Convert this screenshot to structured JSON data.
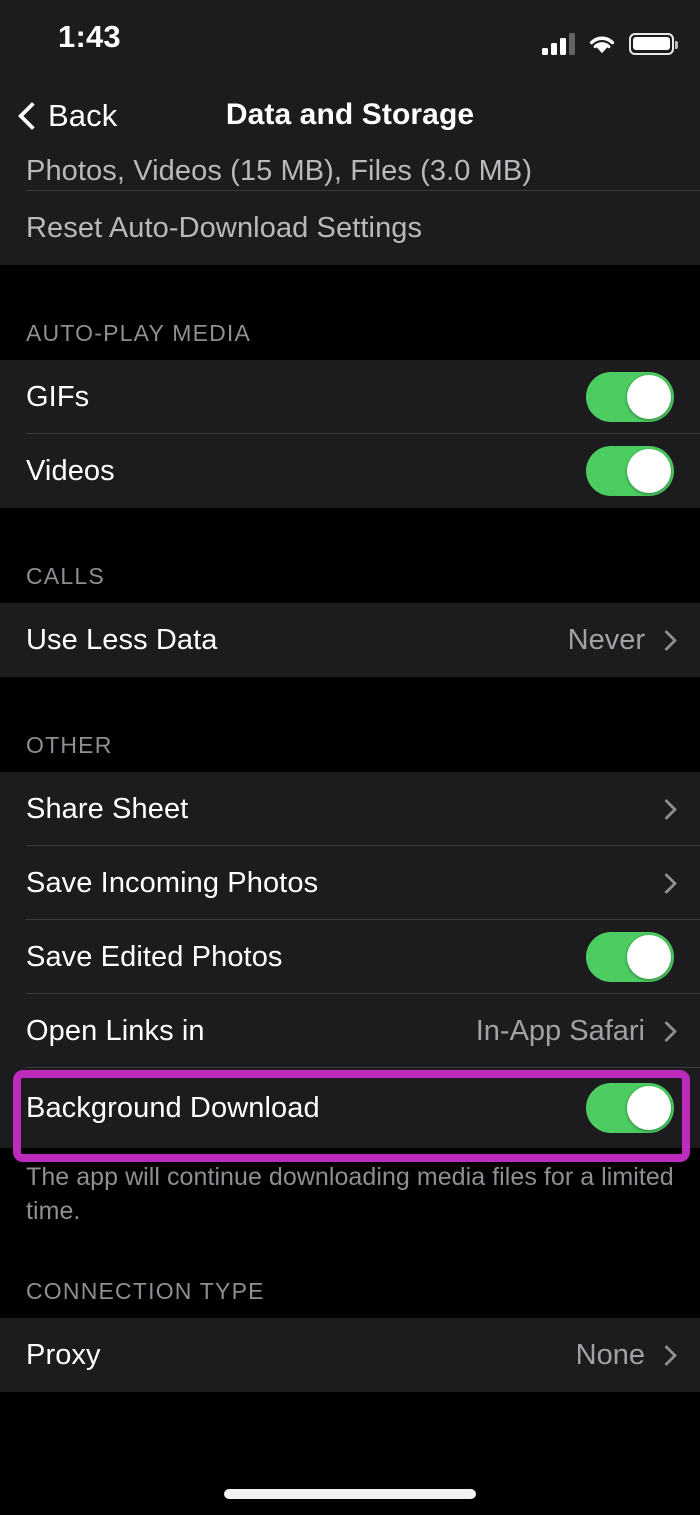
{
  "status_bar": {
    "time": "1:43",
    "signal_icon": "cellular-signal-icon",
    "signal_bars_filled": 3,
    "signal_bars_total": 4,
    "wifi_icon": "wifi-icon",
    "battery_icon": "battery-full-icon"
  },
  "nav": {
    "back_label": "Back",
    "back_icon": "chevron-left-icon",
    "title": "Data and Storage"
  },
  "colors": {
    "group_background": "#1c1c1e",
    "page_background": "#000000",
    "toggle_on": "#4ccc61",
    "highlight": "#bc2bbc",
    "secondary_text": "#8e8e93",
    "divider": "#3a3a3c"
  },
  "sections": [
    {
      "header": "",
      "partial_top_text": "Photos, Videos (15 MB), Files (3.0 MB)",
      "rows": [
        {
          "title": "Reset Auto-Download Settings",
          "type": "action"
        }
      ]
    },
    {
      "header": "AUTO-PLAY MEDIA",
      "rows": [
        {
          "title": "GIFs",
          "type": "toggle",
          "value": "on"
        },
        {
          "title": "Videos",
          "type": "toggle",
          "value": "on"
        }
      ]
    },
    {
      "header": "CALLS",
      "rows": [
        {
          "title": "Use Less Data",
          "type": "disclosure",
          "value": "Never"
        }
      ]
    },
    {
      "header": "OTHER",
      "rows": [
        {
          "title": "Share Sheet",
          "type": "disclosure",
          "value": ""
        },
        {
          "title": "Save Incoming Photos",
          "type": "disclosure",
          "value": ""
        },
        {
          "title": "Save Edited Photos",
          "type": "toggle",
          "value": "on"
        },
        {
          "title": "Open Links in",
          "type": "disclosure",
          "value": "In-App Safari"
        },
        {
          "title": "Background Download",
          "type": "toggle",
          "value": "on",
          "highlighted": true
        }
      ],
      "footnote": "The app will continue downloading media files for a limited time."
    },
    {
      "header": "CONNECTION TYPE",
      "rows": [
        {
          "title": "Proxy",
          "type": "disclosure",
          "value": "None"
        }
      ]
    }
  ]
}
